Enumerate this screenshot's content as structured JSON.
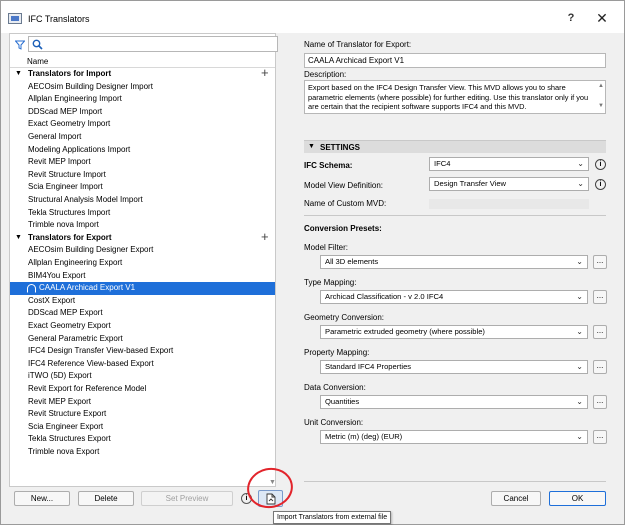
{
  "window": {
    "title": "IFC Translators",
    "help": "?",
    "close": "✕"
  },
  "left": {
    "search_placeholder": "",
    "column_name": "Name",
    "groups": [
      {
        "label": "Translators for Import",
        "items": [
          "AECOsim Building Designer Import",
          "Allplan Engineering Import",
          "DDScad MEP Import",
          "Exact Geometry Import",
          "General Import",
          "Modeling Applications Import",
          "Revit MEP Import",
          "Revit Structure Import",
          "Scia Engineer Import",
          "Structural Analysis Model Import",
          "Tekla Structures Import",
          "Trimble nova Import"
        ]
      },
      {
        "label": "Translators for Export",
        "items": [
          "AECOsim Building Designer Export",
          "Allplan Engineering Export",
          "BIM4You Export",
          "CAALA Archicad Export V1",
          "CostX Export",
          "DDScad MEP Export",
          "Exact Geometry Export",
          "General Parametric Export",
          "IFC4 Design Transfer View-based Export",
          "IFC4 Reference View-based Export",
          "iTWO (5D) Export",
          "Revit Export for Reference Model",
          "Revit MEP Export",
          "Revit Structure Export",
          "Scia Engineer Export",
          "Tekla Structures Export",
          "Trimble nova Export"
        ]
      }
    ],
    "selected": "CAALA Archicad Export V1",
    "buttons": {
      "new": "New...",
      "delete": "Delete",
      "preview": "Set Preview"
    },
    "tooltip": "Import Translators from external file"
  },
  "right": {
    "name_label": "Name of Translator for Export:",
    "name_value": "CAALA Archicad Export V1",
    "desc_label": "Description:",
    "desc_value": "Export based on the IFC4 Design Transfer View. This MVD allows you to share parametric elements (where possible) for further editing. Use this translator only if you are certain that the recipient software supports IFC4 and this MVD.",
    "settings_label": "SETTINGS",
    "schema_label": "IFC Schema:",
    "schema_value": "IFC4",
    "mvd_label": "Model View Definition:",
    "mvd_value": "Design Transfer View",
    "custom_mvd_label": "Name of Custom MVD:",
    "presets_label": "Conversion Presets:",
    "model_filter_label": "Model Filter:",
    "model_filter_value": "All 3D elements",
    "type_mapping_label": "Type Mapping:",
    "type_mapping_value": "Archicad Classification - v 2.0 IFC4",
    "geometry_label": "Geometry Conversion:",
    "geometry_value": "Parametric extruded geometry (where possible)",
    "property_label": "Property Mapping:",
    "property_value": "Standard IFC4 Properties",
    "data_label": "Data Conversion:",
    "data_value": "Quantities",
    "unit_label": "Unit Conversion:",
    "unit_value": "Metric (m) (deg) (EUR)",
    "dots": "...",
    "cancel": "Cancel",
    "ok": "OK"
  }
}
